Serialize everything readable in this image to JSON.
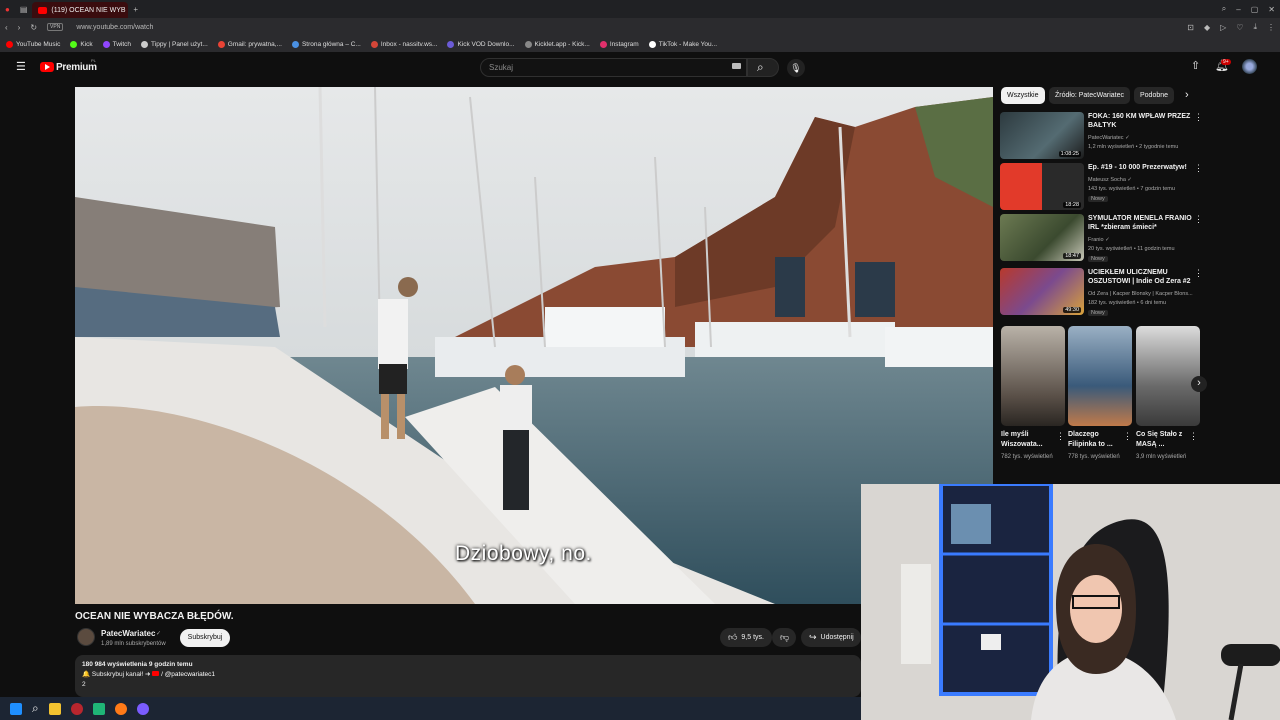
{
  "browser": {
    "tab_title": "(119) OCEAN NIE WYB",
    "url": "www.youtube.com/watch",
    "bookmarks": [
      {
        "label": "YouTube Music",
        "color": "#ff0000"
      },
      {
        "label": "Kick",
        "color": "#53fc18"
      },
      {
        "label": "Twitch",
        "color": "#9146ff"
      },
      {
        "label": "Tippy | Panel użyt...",
        "color": "#cccccc"
      },
      {
        "label": "Gmail: prywatna,...",
        "color": "#ea4335"
      },
      {
        "label": "Strona główna – C...",
        "color": "#4a90e2"
      },
      {
        "label": "Inbox - nassitv.ws...",
        "color": "#d44638"
      },
      {
        "label": "Kick VOD Downlo...",
        "color": "#6b5bd6"
      },
      {
        "label": "Kicklet.app - Kick...",
        "color": "#888888"
      },
      {
        "label": "Instagram",
        "color": "#e1306c"
      },
      {
        "label": "TikTok - Make You...",
        "color": "#ffffff"
      }
    ]
  },
  "header": {
    "logo_text": "Premium",
    "logo_region": "PL",
    "search_placeholder": "Szukaj",
    "notification_count": "9+"
  },
  "video": {
    "subtitle": "Dziobowy, no."
  },
  "meta": {
    "title": "OCEAN NIE WYBACZA BŁĘDÓW.",
    "channel": "PatecWariatec",
    "subscribers": "1,89 mln subskrybentów",
    "subscribe_label": "Subskrybuj",
    "likes": "9,5 tys.",
    "share_label": "Udostępnij",
    "desc_line1": "180 984 wyświetlenia  9 godzin temu",
    "desc_line2": "🔔 Subskrybuj kanał! ➜ ",
    "desc_handle": "/ @patecwariatec1",
    "desc_line3": "2"
  },
  "sidebar": {
    "chips": [
      "Wszystkie",
      "Źródło: PatecWariatec",
      "Podobne"
    ],
    "recommendations": [
      {
        "title": "FOKA: 160 KM WPŁAW PRZEZ BAŁTYK",
        "channel": "PatecWariatec ✓",
        "stats": "1,2 mln wyświetleń • 2 tygodnie temu",
        "duration": "1:08:25",
        "badge": ""
      },
      {
        "title": "Ep. #19 - 10 000 Prezerwatyw!",
        "channel": "Mateusz Socha ✓",
        "stats": "143 tys. wyświetleń • 7 godzin temu",
        "duration": "18:28",
        "badge": "Nowy"
      },
      {
        "title": "SYMULATOR MENELA FRANIO IRL *zbieram śmieci*",
        "channel": "Franio ✓",
        "stats": "20 tys. wyświetleń • 11 godzin temu",
        "duration": "18:47",
        "badge": "Nowy"
      },
      {
        "title": "UCIEKŁEM ULICZNEMU OSZUSTOWI | Indie Od Zera #2",
        "channel": "Od Zera | Kacper Blonsky | Kacper Blons...",
        "stats": "182 tys. wyświetleń • 6 dni temu",
        "duration": "49:30",
        "badge": "Nowy"
      }
    ],
    "shorts": [
      {
        "title": "Ile myśli Wiszowata...",
        "views": "782 tys. wyświetleń"
      },
      {
        "title": "Dlaczego Filipinka to ...",
        "views": "778 tys. wyświetleń"
      },
      {
        "title": "Co Się Stało z MASĄ ...",
        "views": "3,9 mln wyświetleń"
      }
    ]
  }
}
